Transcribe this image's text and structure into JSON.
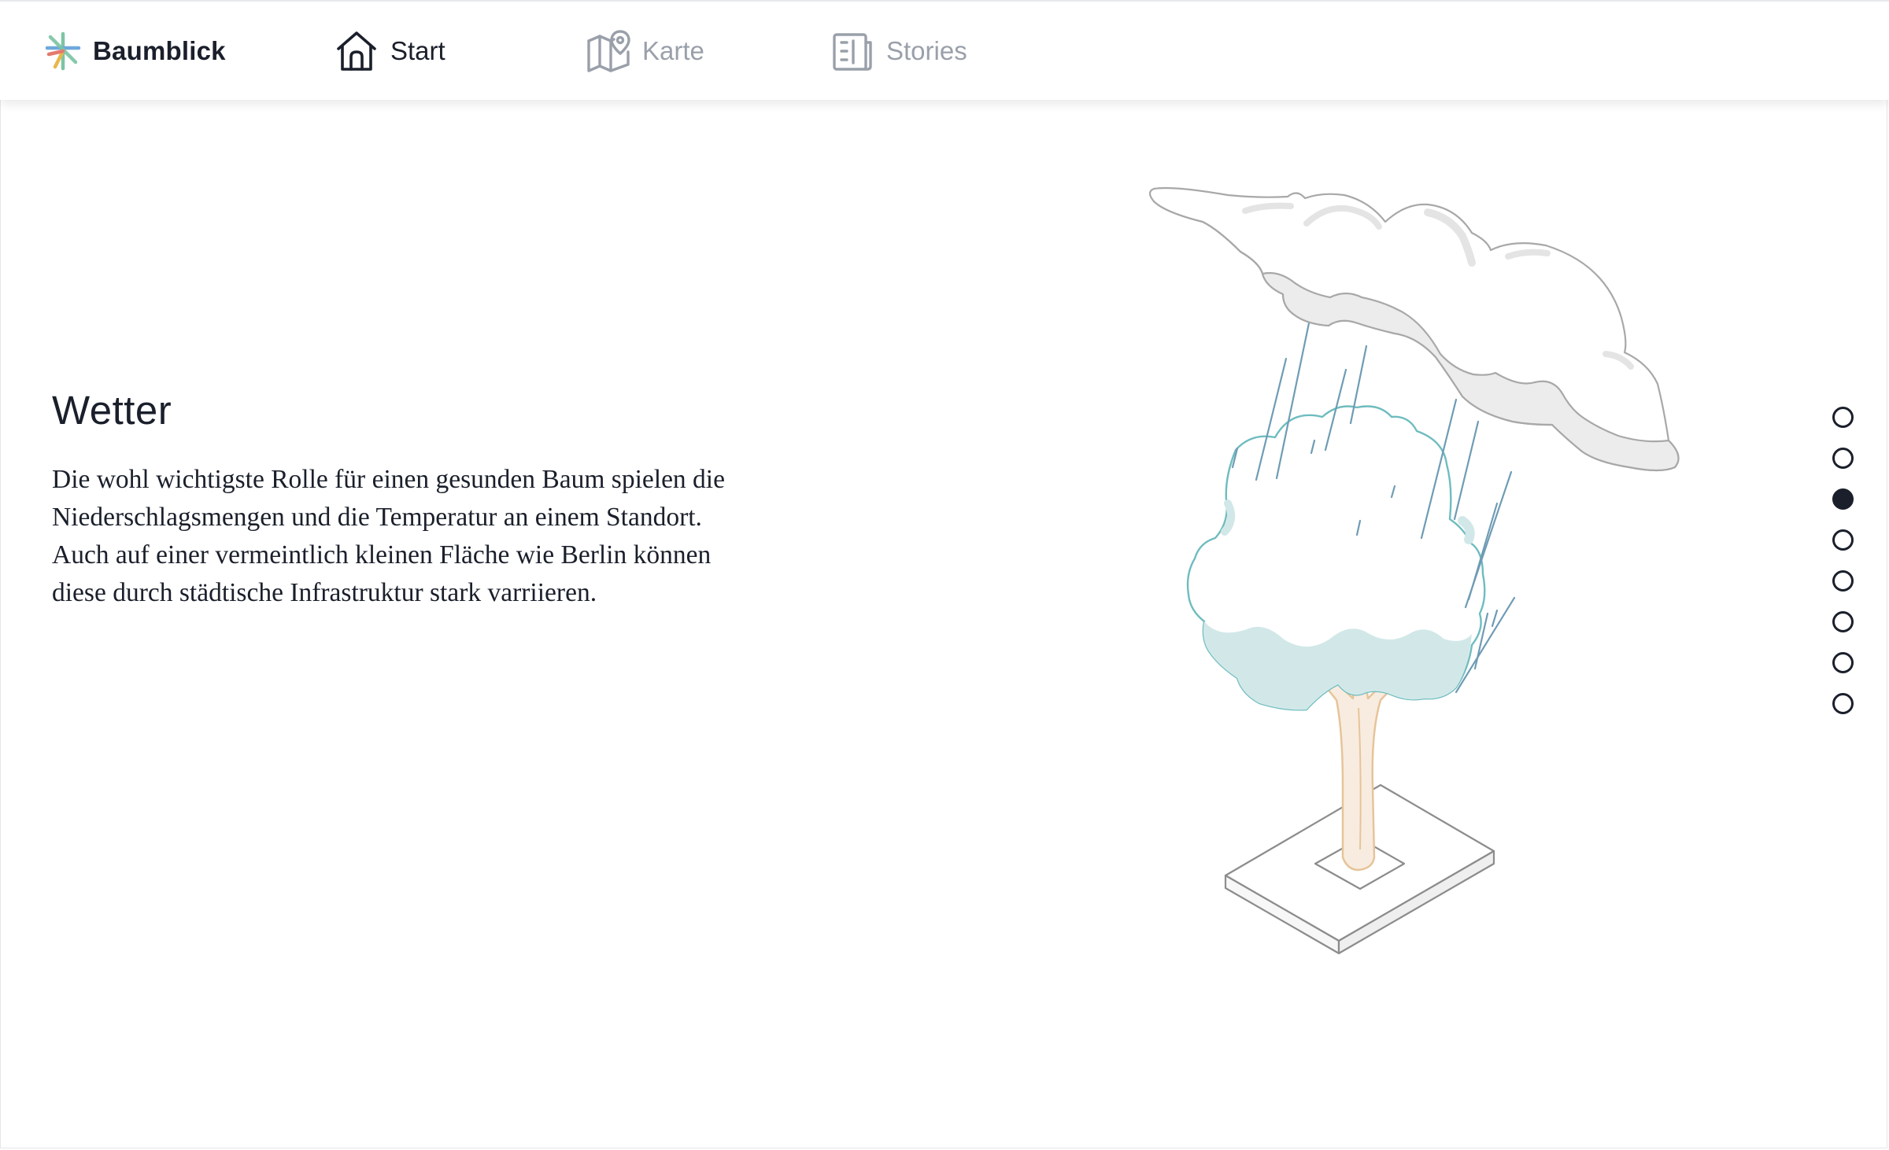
{
  "app": {
    "brand_name": "Baumblick",
    "brand_colors": [
      "#e8b84a",
      "#7cc4a4",
      "#e37a6f",
      "#6fa8dc"
    ]
  },
  "nav": {
    "items": [
      {
        "label": "Start",
        "icon": "home-icon",
        "active": true
      },
      {
        "label": "Karte",
        "icon": "map-pin-icon",
        "active": false
      },
      {
        "label": "Stories",
        "icon": "newspaper-icon",
        "active": false
      }
    ]
  },
  "section": {
    "title": "Wetter",
    "body": "Die wohl wichtigste Rolle für einen gesunden Baum spielen die Niederschlagsmengen und die Temperatur an einem Standort. Auch auf einer vermeintlich kleinen Fläche wie Ber­lin können diese durch städtische Infrastruktur stark varriieren."
  },
  "illustration": {
    "icon": "tree-with-rain-cloud-illustration",
    "colors": {
      "cloud": "#ececec",
      "cloud_outline": "#a8a8a8",
      "crown": "#d2e8e8",
      "crown_outline": "#6fbcbf",
      "rain": "#6f9cb4",
      "trunk": "#f8ece0",
      "trunk_outline": "#e6c49a",
      "base_outline": "#8c8c8c"
    }
  },
  "steps": {
    "count": 8,
    "active_index": 2
  },
  "theme": {
    "text": "#1a1f2b",
    "muted": "#9aa0aa"
  }
}
